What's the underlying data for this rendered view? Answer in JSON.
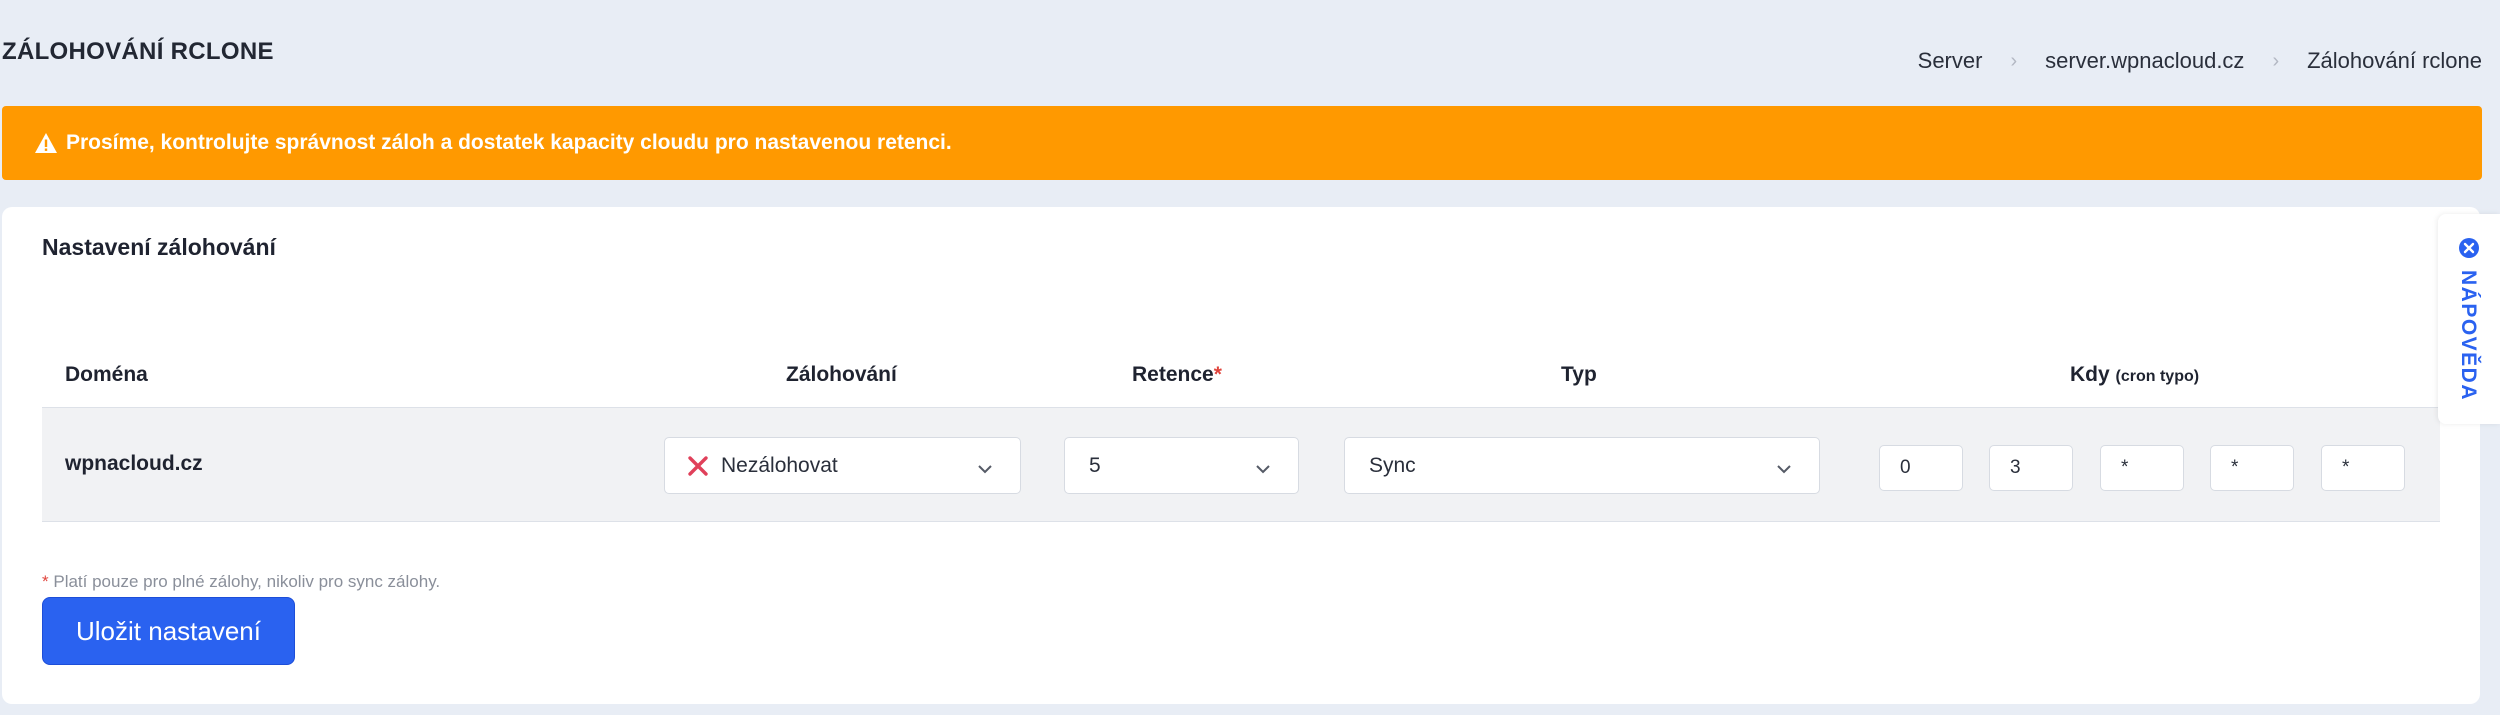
{
  "page": {
    "title": "ZÁLOHOVÁNÍ RCLONE"
  },
  "breadcrumb": {
    "items": [
      "Server",
      "server.wpnacloud.cz",
      "Zálohování rclone"
    ]
  },
  "alert": {
    "text": "Prosíme, kontrolujte správnost záloh a dostatek kapacity cloudu pro nastavenou retenci.",
    "icon": "warning-icon",
    "color": "#ff9900"
  },
  "card": {
    "title": "Nastavení zálohování",
    "columns": {
      "domain": "Doména",
      "backup": "Zálohování",
      "retention": "Retence",
      "required_mark": "*",
      "type": "Typ",
      "when": "Kdy",
      "when_hint": "(cron typo)"
    },
    "row": {
      "domain": "wpnacloud.cz",
      "backup_value": "Nezálohovat",
      "backup_icon": "x-icon",
      "retention_value": "5",
      "type_value": "Sync",
      "cron": [
        "0",
        "3",
        "*",
        "*",
        "*"
      ]
    },
    "footnote": {
      "mark": "*",
      "text": "Platí pouze pro plné zálohy, nikoliv pro sync zálohy."
    },
    "save_label": "Uložit nastavení"
  },
  "help": {
    "label": "NÁPOVĚDA",
    "icon": "close-icon"
  },
  "colors": {
    "accent": "#2a62f0",
    "warning": "#ff9900",
    "required": "#e0443c",
    "background": "#e8edf5"
  }
}
